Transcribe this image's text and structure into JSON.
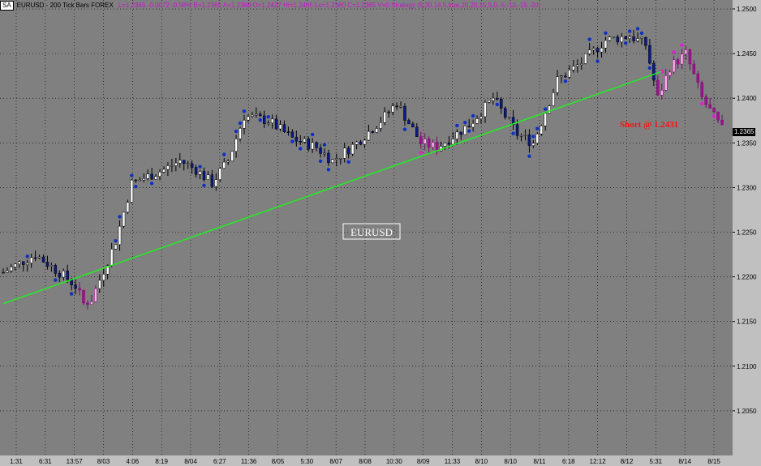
{
  "header": {
    "symbol_badge": "SA",
    "title": "EURUSD - 200 Tick Bars  FOREX",
    "stats": "L=1.2365  -0.0072  -0.58%  B=1.2365  A=1.2368  O=1.2437  Hi=1.2465  Lo=1.2360  C=1.2365  V=0  Strategy  (5,20,14,5,true,20,20,15,5,0,-5,-10,-15,-20)"
  },
  "price_label": "1.2365",
  "chart_label": "EURUSD",
  "annotation": "Short @ 1.2431",
  "colors": {
    "background": "#808080",
    "bar_up": "#ffffff",
    "bar_down": "#0a1a8a",
    "dot_blue": "#1030c0",
    "dot_magenta": "#e020d0",
    "trendline": "#22ee22",
    "annotation": "#ff1010",
    "axis_text": "#000000"
  },
  "chart_data": {
    "type": "candlestick",
    "series_name": "EURUSD",
    "ylim": [
      1.2,
      1.251
    ],
    "y_ticks": [
      "1.2050",
      "1.2100",
      "1.2150",
      "1.2200",
      "1.2250",
      "1.2300",
      "1.2350",
      "1.2400",
      "1.2450",
      "1.2500"
    ],
    "x_tick_labels": [
      "1:31",
      "6:31",
      "13:57",
      "8/03",
      "4:06",
      "8:19",
      "8/04",
      "6:27",
      "11:36",
      "8/05",
      "5:30",
      "8/07",
      "8/08",
      "10:30",
      "8/09",
      "11:33",
      "8/10",
      "8/10",
      "8/11",
      "6:18",
      "12:12",
      "8/12",
      "5:31",
      "8/14",
      "8/15"
    ],
    "n_bars": 180,
    "price_path": [
      [
        0,
        1.2205
      ],
      [
        8,
        1.2225
      ],
      [
        14,
        1.2205
      ],
      [
        18,
        1.219
      ],
      [
        20,
        1.217
      ],
      [
        22,
        1.2175
      ],
      [
        28,
        1.224
      ],
      [
        32,
        1.2305
      ],
      [
        40,
        1.232
      ],
      [
        44,
        1.233
      ],
      [
        48,
        1.232
      ],
      [
        52,
        1.2305
      ],
      [
        56,
        1.233
      ],
      [
        60,
        1.238
      ],
      [
        66,
        1.2375
      ],
      [
        72,
        1.2355
      ],
      [
        78,
        1.2345
      ],
      [
        82,
        1.233
      ],
      [
        88,
        1.235
      ],
      [
        94,
        1.2375
      ],
      [
        98,
        1.2395
      ],
      [
        104,
        1.235
      ],
      [
        108,
        1.2345
      ],
      [
        116,
        1.237
      ],
      [
        122,
        1.24
      ],
      [
        128,
        1.236
      ],
      [
        132,
        1.235
      ],
      [
        138,
        1.242
      ],
      [
        144,
        1.244
      ],
      [
        150,
        1.2465
      ],
      [
        156,
        1.247
      ],
      [
        160,
        1.246
      ],
      [
        163,
        1.24
      ],
      [
        166,
        1.2435
      ],
      [
        170,
        1.245
      ],
      [
        174,
        1.24
      ],
      [
        179,
        1.2365
      ]
    ],
    "magenta_bar_ranges": [
      [
        19,
        23
      ],
      [
        104,
        108
      ],
      [
        163,
        179
      ]
    ],
    "trendline": {
      "from": [
        0,
        1.217
      ],
      "to": [
        164,
        1.243
      ],
      "color": "#22ee22"
    },
    "annotation": {
      "text": "Short @ 1.2431",
      "x": 152,
      "y": 1.2385
    },
    "chart_label_position": [
      93,
      1.225
    ],
    "last_price": 1.2365
  }
}
